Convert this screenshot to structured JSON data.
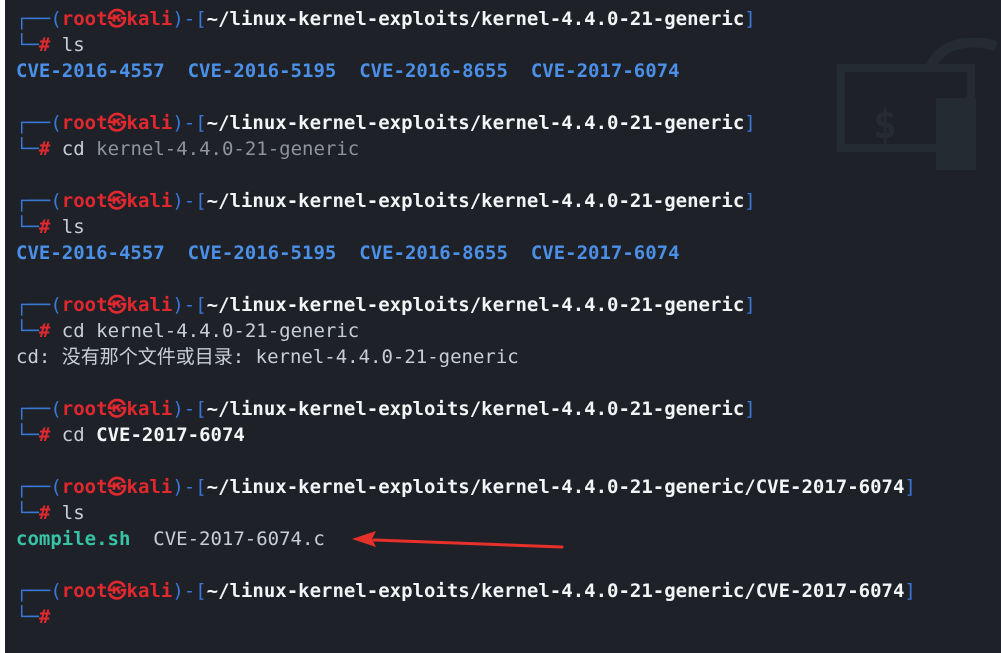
{
  "prompt": {
    "user": "root",
    "skull": "㉿",
    "host": "kali",
    "hash": "#",
    "box_top": "┌──(",
    "box_mid": ")-[",
    "box_end": "]",
    "box_bottom": "└─"
  },
  "paths": {
    "kernel_dir": "~/linux-kernel-exploits/kernel-4.4.0-21-generic",
    "cve_dir": "~/linux-kernel-exploits/kernel-4.4.0-21-generic/CVE-2017-6074"
  },
  "blocks": [
    {
      "command": "ls",
      "output_dirs": [
        "CVE-2016-4557",
        "CVE-2016-5195",
        "CVE-2016-8655",
        "CVE-2017-6074"
      ]
    },
    {
      "command": "cd",
      "argument": "kernel-4.4.0-21-generic"
    },
    {
      "command": "ls",
      "output_dirs": [
        "CVE-2016-4557",
        "CVE-2016-5195",
        "CVE-2016-8655",
        "CVE-2017-6074"
      ]
    },
    {
      "command": "cd",
      "argument": "kernel-4.4.0-21-generic",
      "error": "cd: 没有那个文件或目录: kernel-4.4.0-21-generic"
    },
    {
      "command": "cd",
      "argument": "CVE-2017-6074"
    },
    {
      "command": "ls",
      "output_files": [
        "compile.sh",
        "CVE-2017-6074.c"
      ]
    }
  ],
  "colors": {
    "background": "#1e2228",
    "box_blue": "#3a78d8",
    "prompt_red": "#e0282e",
    "dir_blue": "#4b8fe6",
    "exe_teal": "#37c3a6",
    "arrow_red": "#e8302a"
  }
}
